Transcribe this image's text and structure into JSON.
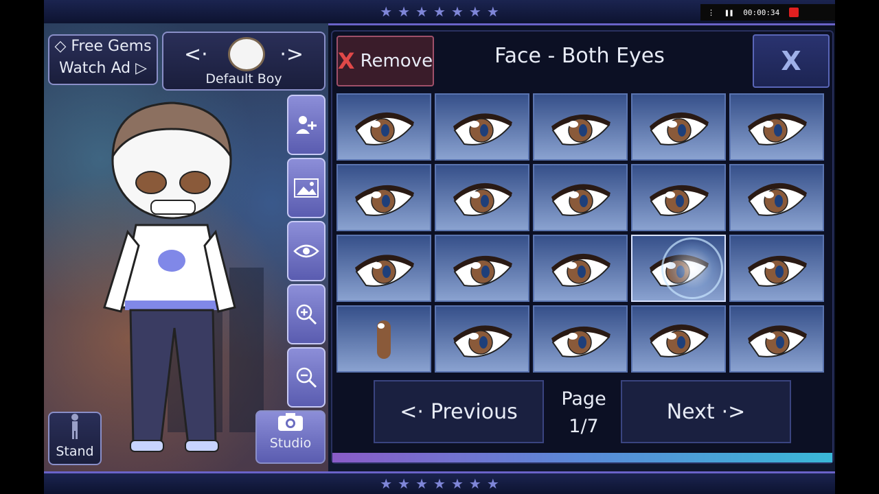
{
  "recorder": {
    "time": "00:00:34"
  },
  "gems": {
    "line1": "Free Gems",
    "line2": "Watch Ad ▷"
  },
  "character": {
    "prev_arrow": "<·",
    "next_arrow": "·>",
    "name": "Default Boy"
  },
  "toolbar": {
    "add_user": "add-user",
    "background": "image",
    "visibility": "eye",
    "zoom_in": "zoom-in",
    "zoom_out": "zoom-out"
  },
  "stand": {
    "label": "Stand"
  },
  "studio": {
    "label": "Studio"
  },
  "panel": {
    "remove_label": "Remove",
    "remove_x": "X",
    "title": "Face - Both Eyes",
    "close_label": "X",
    "selected_index": 13,
    "items": [
      "eye-1",
      "eye-2",
      "eye-3",
      "eye-4",
      "eye-5",
      "eye-6",
      "eye-7",
      "eye-8",
      "eye-9",
      "eye-10",
      "eye-11",
      "eye-12",
      "eye-13",
      "eye-14",
      "eye-15",
      "eye-16",
      "eye-17",
      "eye-18",
      "eye-19",
      "eye-20"
    ]
  },
  "pagination": {
    "previous": "Previous",
    "next": "Next",
    "page_label": "Page",
    "page_value": "1/7"
  },
  "colors": {
    "iris_brown": "#8a5a3a",
    "pupil_blue": "#1e3f7a",
    "panel_bg": "#0c1024"
  }
}
